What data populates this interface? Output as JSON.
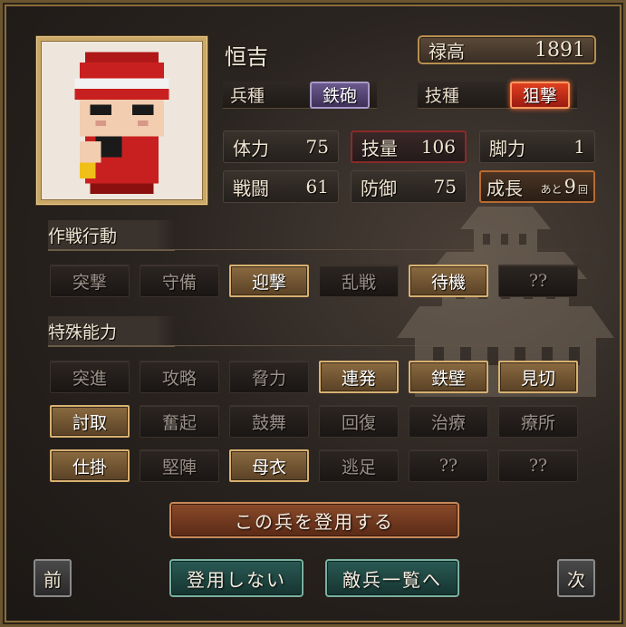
{
  "unit": {
    "name": "恒吉",
    "salary_label": "禄高",
    "salary_value": "1891",
    "troop_type_label": "兵種",
    "troop_type_value": "鉄砲",
    "skill_type_label": "技種",
    "skill_type_value": "狙撃"
  },
  "stats": {
    "hp_label": "体力",
    "hp_value": "75",
    "skill_label": "技量",
    "skill_value": "106",
    "leg_label": "脚力",
    "leg_value": "1",
    "combat_label": "戦闘",
    "combat_value": "61",
    "defense_label": "防御",
    "defense_value": "75",
    "growth_label": "成長",
    "growth_prefix": "あと",
    "growth_value": "9",
    "growth_unit": "回"
  },
  "tactics": {
    "title": "作戦行動",
    "buttons": [
      {
        "label": "突撃",
        "active": false
      },
      {
        "label": "守備",
        "active": false
      },
      {
        "label": "迎撃",
        "active": true
      },
      {
        "label": "乱戦",
        "active": false
      },
      {
        "label": "待機",
        "active": true
      },
      {
        "label": "??",
        "active": false
      }
    ]
  },
  "abilities": {
    "title": "特殊能力",
    "buttons": [
      {
        "label": "突進",
        "active": false
      },
      {
        "label": "攻略",
        "active": false
      },
      {
        "label": "脅力",
        "active": false
      },
      {
        "label": "連発",
        "active": true
      },
      {
        "label": "鉄壁",
        "active": true
      },
      {
        "label": "見切",
        "active": true
      },
      {
        "label": "討取",
        "active": true
      },
      {
        "label": "奮起",
        "active": false
      },
      {
        "label": "鼓舞",
        "active": false
      },
      {
        "label": "回復",
        "active": false
      },
      {
        "label": "治療",
        "active": false
      },
      {
        "label": "療所",
        "active": false
      },
      {
        "label": "仕掛",
        "active": true
      },
      {
        "label": "堅陣",
        "active": false
      },
      {
        "label": "母衣",
        "active": true
      },
      {
        "label": "逃足",
        "active": false
      },
      {
        "label": "??",
        "active": false
      },
      {
        "label": "??",
        "active": false
      }
    ]
  },
  "actions": {
    "recruit": "この兵を登用する",
    "decline": "登用しない",
    "enemy_list": "敵兵一覧へ",
    "prev": "前",
    "next": "次"
  },
  "colors": {
    "accent_gold": "#b99050",
    "active_button": "#8a6a40",
    "skill_badge": "#e04020",
    "troop_badge": "#6b5a8c"
  }
}
